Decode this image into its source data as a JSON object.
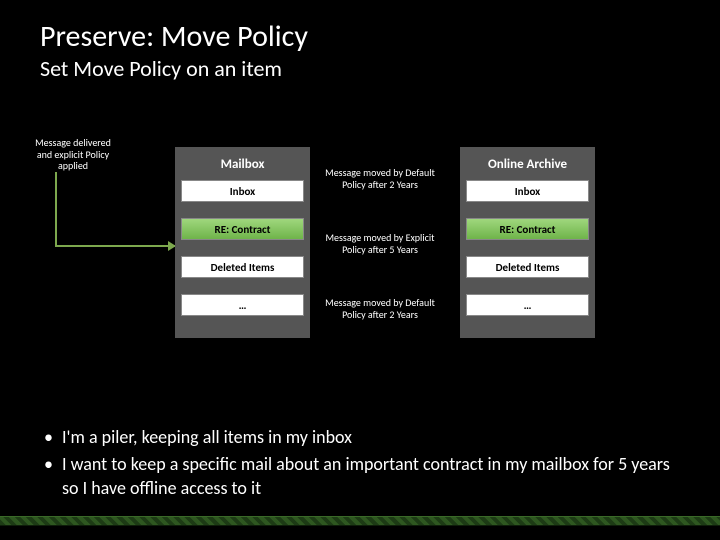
{
  "title": "Preserve: Move Policy",
  "subtitle": "Set Move Policy on an item",
  "annotations": {
    "left": "Message delivered and explicit Policy applied",
    "center1": "Message moved by Default Policy after 2 Years",
    "center2": "Message moved by Explicit Policy after 5 Years",
    "center3": "Message moved by Default Policy after 2 Years"
  },
  "mailbox": {
    "header": "Mailbox",
    "items": [
      "Inbox",
      "RE: Contract",
      "Deleted Items",
      "…"
    ],
    "highlight_index": 1
  },
  "archive": {
    "header": "Online Archive",
    "items": [
      "Inbox",
      "RE: Contract",
      "Deleted Items",
      "…"
    ],
    "highlight_index": 1
  },
  "bullets": [
    "I'm a piler, keeping all items in my inbox",
    "I want to keep a specific mail about an important contract in my mailbox for 5 years so I have offline access to it"
  ]
}
